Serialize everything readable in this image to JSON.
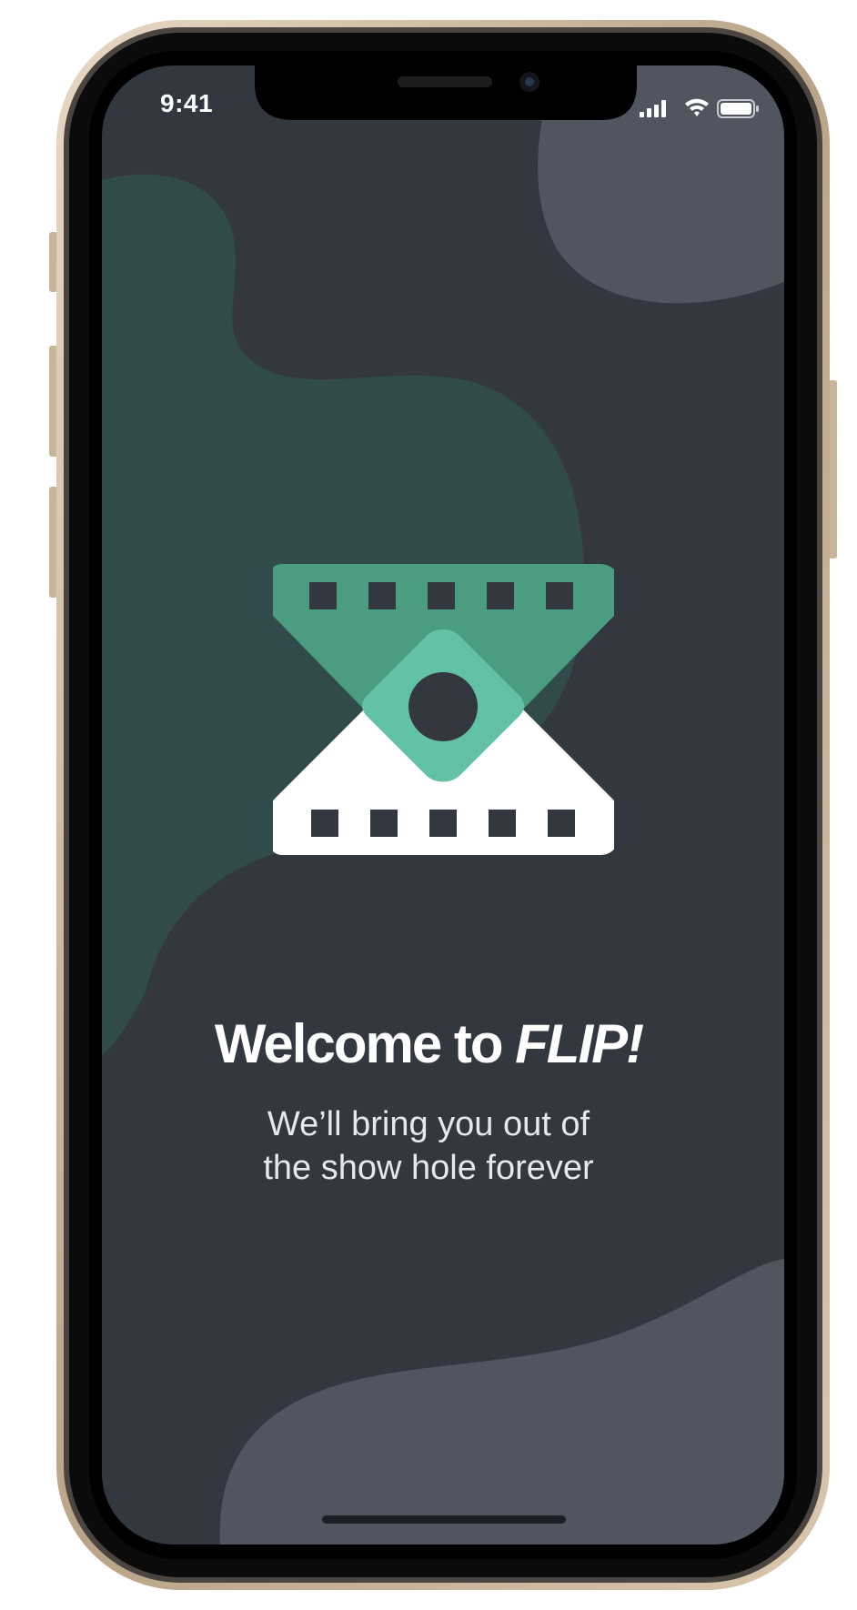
{
  "status_bar": {
    "time": "9:41"
  },
  "welcome": {
    "title_prefix": "Welcome to ",
    "title_brand": "FLIP!",
    "subtitle_lines": [
      "We’ll bring you out of",
      "the show hole forever"
    ]
  },
  "icons": {
    "signal": "cellular-signal-icon",
    "wifi": "wifi-icon",
    "battery": "battery-icon",
    "logo": "flip-film-reel-logo"
  },
  "colors": {
    "background": "#323740",
    "blob_green": "#314b4c",
    "blob_gray": "#505560",
    "logo_dark_green": "#4a9d80",
    "logo_light_green": "#63c2a5",
    "logo_white": "#ffffff"
  }
}
